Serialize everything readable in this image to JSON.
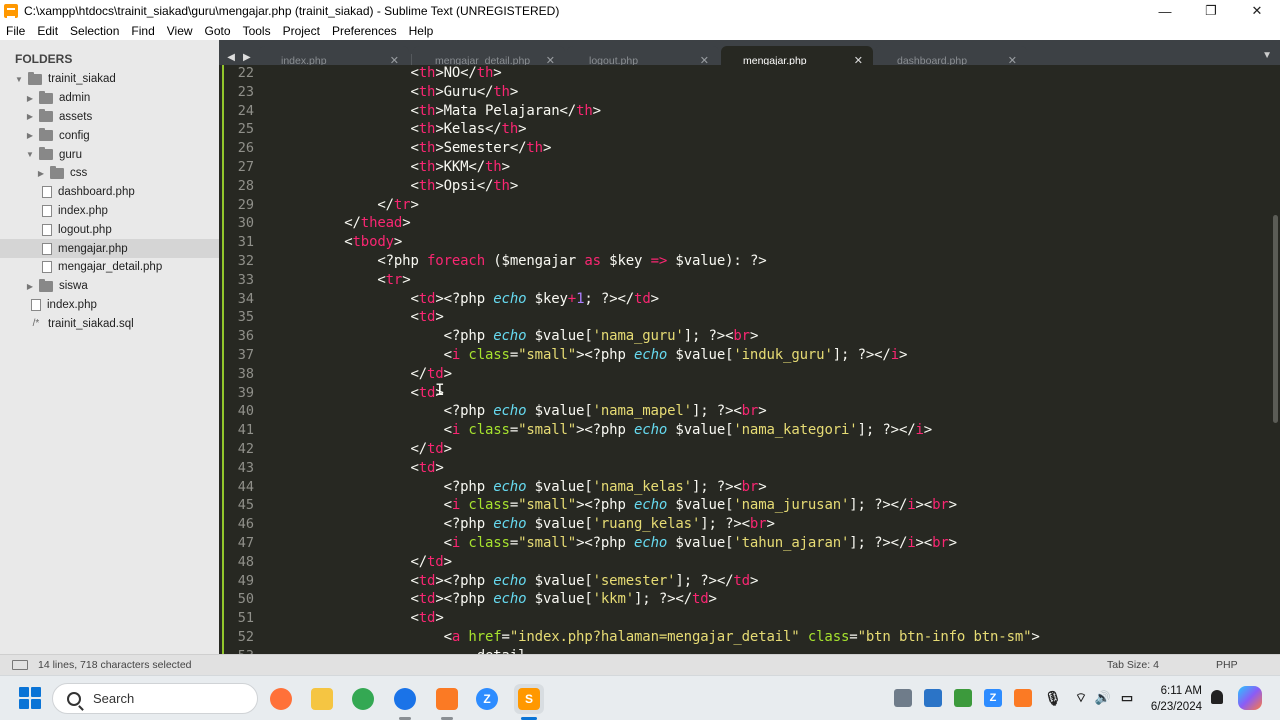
{
  "window": {
    "title": "C:\\xampp\\htdocs\\trainit_siakad\\guru\\mengajar.php (trainit_siakad) - Sublime Text (UNREGISTERED)",
    "controls": [
      "—",
      "❐",
      "✕"
    ]
  },
  "menu": [
    "File",
    "Edit",
    "Selection",
    "Find",
    "View",
    "Goto",
    "Tools",
    "Project",
    "Preferences",
    "Help"
  ],
  "sidebar": {
    "title": "FOLDERS",
    "tree": [
      {
        "label": "trainit_siakad",
        "type": "folder",
        "depth": 0,
        "expanded": true
      },
      {
        "label": "admin",
        "type": "folder",
        "depth": 1,
        "expanded": false
      },
      {
        "label": "assets",
        "type": "folder",
        "depth": 1,
        "expanded": false
      },
      {
        "label": "config",
        "type": "folder",
        "depth": 1,
        "expanded": false
      },
      {
        "label": "guru",
        "type": "folder",
        "depth": 1,
        "expanded": true
      },
      {
        "label": "css",
        "type": "folder",
        "depth": 2,
        "expanded": false
      },
      {
        "label": "dashboard.php",
        "type": "file",
        "depth": 2
      },
      {
        "label": "index.php",
        "type": "file",
        "depth": 2
      },
      {
        "label": "logout.php",
        "type": "file",
        "depth": 2
      },
      {
        "label": "mengajar.php",
        "type": "file",
        "depth": 2,
        "selected": true
      },
      {
        "label": "mengajar_detail.php",
        "type": "file",
        "depth": 2
      },
      {
        "label": "siswa",
        "type": "folder",
        "depth": 1,
        "expanded": false
      },
      {
        "label": "index.php",
        "type": "file",
        "depth": 1
      },
      {
        "label": "trainit_siakad.sql",
        "type": "sql",
        "depth": 1
      }
    ]
  },
  "tabs": [
    {
      "label": "index.php",
      "active": false
    },
    {
      "label": "mengajar_detail.php",
      "active": false
    },
    {
      "label": "logout.php",
      "active": false
    },
    {
      "label": "mengajar.php",
      "active": true
    },
    {
      "label": "dashboard.php",
      "active": false
    }
  ],
  "editor": {
    "lines": [
      {
        "n": "22",
        "segs": [
          [
            "",
            "                <"
          ],
          [
            "tag",
            "th"
          ],
          [
            "",
            ">NO</"
          ],
          [
            "tag",
            "th"
          ],
          [
            "",
            ">"
          ]
        ]
      },
      {
        "n": "23",
        "segs": [
          [
            "",
            "                <"
          ],
          [
            "tag",
            "th"
          ],
          [
            "",
            ">Guru</"
          ],
          [
            "tag",
            "th"
          ],
          [
            "",
            ">"
          ]
        ]
      },
      {
        "n": "24",
        "segs": [
          [
            "",
            "                <"
          ],
          [
            "tag",
            "th"
          ],
          [
            "",
            ">Mata Pelajaran</"
          ],
          [
            "tag",
            "th"
          ],
          [
            "",
            ">"
          ]
        ]
      },
      {
        "n": "25",
        "segs": [
          [
            "",
            "                <"
          ],
          [
            "tag",
            "th"
          ],
          [
            "",
            ">Kelas</"
          ],
          [
            "tag",
            "th"
          ],
          [
            "",
            ">"
          ]
        ]
      },
      {
        "n": "26",
        "segs": [
          [
            "",
            "                <"
          ],
          [
            "tag",
            "th"
          ],
          [
            "",
            ">Semester</"
          ],
          [
            "tag",
            "th"
          ],
          [
            "",
            ">"
          ]
        ]
      },
      {
        "n": "27",
        "segs": [
          [
            "",
            "                <"
          ],
          [
            "tag",
            "th"
          ],
          [
            "",
            ">KKM</"
          ],
          [
            "tag",
            "th"
          ],
          [
            "",
            ">"
          ]
        ]
      },
      {
        "n": "28",
        "segs": [
          [
            "",
            "                <"
          ],
          [
            "tag",
            "th"
          ],
          [
            "",
            ">Opsi</"
          ],
          [
            "tag",
            "th"
          ],
          [
            "",
            ">"
          ]
        ]
      },
      {
        "n": "29",
        "segs": [
          [
            "",
            "            </"
          ],
          [
            "tag",
            "tr"
          ],
          [
            "",
            ">"
          ]
        ]
      },
      {
        "n": "30",
        "segs": [
          [
            "",
            "        </"
          ],
          [
            "tag",
            "thead"
          ],
          [
            "",
            ">"
          ]
        ]
      },
      {
        "n": "31",
        "segs": [
          [
            "",
            "        <"
          ],
          [
            "tag",
            "tbody"
          ],
          [
            "",
            ">"
          ]
        ]
      },
      {
        "n": "32",
        "segs": [
          [
            "",
            "            <?php "
          ],
          [
            "ctl",
            "foreach"
          ],
          [
            "",
            " ($mengajar "
          ],
          [
            "ctl",
            "as"
          ],
          [
            "",
            " $key "
          ],
          [
            "op",
            "=>"
          ],
          [
            "",
            " $value): ?>"
          ]
        ]
      },
      {
        "n": "33",
        "segs": [
          [
            "",
            "            <"
          ],
          [
            "tag",
            "tr"
          ],
          [
            "",
            ">"
          ]
        ]
      },
      {
        "n": "34",
        "segs": [
          [
            "",
            "                <"
          ],
          [
            "tag",
            "td"
          ],
          [
            "",
            "><?php "
          ],
          [
            "kw",
            "echo"
          ],
          [
            "",
            " $key"
          ],
          [
            "op",
            "+"
          ],
          [
            "num",
            "1"
          ],
          [
            "",
            "; ?></"
          ],
          [
            "tag",
            "td"
          ],
          [
            "",
            ">"
          ]
        ]
      },
      {
        "n": "35",
        "segs": [
          [
            "",
            "                <"
          ],
          [
            "tag",
            "td"
          ],
          [
            "",
            ">"
          ]
        ]
      },
      {
        "n": "36",
        "segs": [
          [
            "",
            "                    <?php "
          ],
          [
            "kw",
            "echo"
          ],
          [
            "",
            " $value["
          ],
          [
            "str",
            "'nama_guru'"
          ],
          [
            "",
            "]; ?><"
          ],
          [
            "tag",
            "br"
          ],
          [
            "",
            ">"
          ]
        ]
      },
      {
        "n": "37",
        "segs": [
          [
            "",
            "                    <"
          ],
          [
            "tag",
            "i"
          ],
          [
            "",
            " "
          ],
          [
            "attr",
            "class"
          ],
          [
            "",
            "="
          ],
          [
            "str",
            "\"small\""
          ],
          [
            "",
            "><?php "
          ],
          [
            "kw",
            "echo"
          ],
          [
            "",
            " $value["
          ],
          [
            "str",
            "'induk_guru'"
          ],
          [
            "",
            "]; ?></"
          ],
          [
            "tag",
            "i"
          ],
          [
            "",
            ">"
          ]
        ]
      },
      {
        "n": "38",
        "segs": [
          [
            "",
            "                </"
          ],
          [
            "tag",
            "td"
          ],
          [
            "",
            ">"
          ]
        ]
      },
      {
        "n": "39",
        "segs": [
          [
            "",
            "                <"
          ],
          [
            "tag",
            "td"
          ],
          [
            "",
            ">"
          ]
        ]
      },
      {
        "n": "40",
        "segs": [
          [
            "",
            "                    <?php "
          ],
          [
            "kw",
            "echo"
          ],
          [
            "",
            " $value["
          ],
          [
            "str",
            "'nama_mapel'"
          ],
          [
            "",
            "]; ?><"
          ],
          [
            "tag",
            "br"
          ],
          [
            "",
            ">"
          ]
        ]
      },
      {
        "n": "41",
        "segs": [
          [
            "",
            "                    <"
          ],
          [
            "tag",
            "i"
          ],
          [
            "",
            " "
          ],
          [
            "attr",
            "class"
          ],
          [
            "",
            "="
          ],
          [
            "str",
            "\"small\""
          ],
          [
            "",
            "><?php "
          ],
          [
            "kw",
            "echo"
          ],
          [
            "",
            " $value["
          ],
          [
            "str",
            "'nama_kategori'"
          ],
          [
            "",
            "]; ?></"
          ],
          [
            "tag",
            "i"
          ],
          [
            "",
            ">"
          ]
        ]
      },
      {
        "n": "42",
        "segs": [
          [
            "",
            "                </"
          ],
          [
            "tag",
            "td"
          ],
          [
            "",
            ">"
          ]
        ]
      },
      {
        "n": "43",
        "segs": [
          [
            "",
            "                <"
          ],
          [
            "tag",
            "td"
          ],
          [
            "",
            ">"
          ]
        ]
      },
      {
        "n": "44",
        "segs": [
          [
            "",
            "                    <?php "
          ],
          [
            "kw",
            "echo"
          ],
          [
            "",
            " $value["
          ],
          [
            "str",
            "'nama_kelas'"
          ],
          [
            "",
            "]; ?><"
          ],
          [
            "tag",
            "br"
          ],
          [
            "",
            ">"
          ]
        ]
      },
      {
        "n": "45",
        "segs": [
          [
            "",
            "                    <"
          ],
          [
            "tag",
            "i"
          ],
          [
            "",
            " "
          ],
          [
            "attr",
            "class"
          ],
          [
            "",
            "="
          ],
          [
            "str",
            "\"small\""
          ],
          [
            "",
            "><?php "
          ],
          [
            "kw",
            "echo"
          ],
          [
            "",
            " $value["
          ],
          [
            "str",
            "'nama_jurusan'"
          ],
          [
            "",
            "]; ?></"
          ],
          [
            "tag",
            "i"
          ],
          [
            "",
            "><"
          ],
          [
            "tag",
            "br"
          ],
          [
            "",
            ">"
          ]
        ]
      },
      {
        "n": "46",
        "segs": [
          [
            "",
            "                    <?php "
          ],
          [
            "kw",
            "echo"
          ],
          [
            "",
            " $value["
          ],
          [
            "str",
            "'ruang_kelas'"
          ],
          [
            "",
            "]; ?><"
          ],
          [
            "tag",
            "br"
          ],
          [
            "",
            ">"
          ]
        ]
      },
      {
        "n": "47",
        "segs": [
          [
            "",
            "                    <"
          ],
          [
            "tag",
            "i"
          ],
          [
            "",
            " "
          ],
          [
            "attr",
            "class"
          ],
          [
            "",
            "="
          ],
          [
            "str",
            "\"small\""
          ],
          [
            "",
            "><?php "
          ],
          [
            "kw",
            "echo"
          ],
          [
            "",
            " $value["
          ],
          [
            "str",
            "'tahun_ajaran'"
          ],
          [
            "",
            "]; ?></"
          ],
          [
            "tag",
            "i"
          ],
          [
            "",
            "><"
          ],
          [
            "tag",
            "br"
          ],
          [
            "",
            ">"
          ]
        ]
      },
      {
        "n": "48",
        "segs": [
          [
            "",
            "                </"
          ],
          [
            "tag",
            "td"
          ],
          [
            "",
            ">"
          ]
        ]
      },
      {
        "n": "49",
        "segs": [
          [
            "",
            "                <"
          ],
          [
            "tag",
            "td"
          ],
          [
            "",
            "><?php "
          ],
          [
            "kw",
            "echo"
          ],
          [
            "",
            " $value["
          ],
          [
            "str",
            "'semester'"
          ],
          [
            "",
            "]; ?></"
          ],
          [
            "tag",
            "td"
          ],
          [
            "",
            ">"
          ]
        ]
      },
      {
        "n": "50",
        "segs": [
          [
            "",
            "                <"
          ],
          [
            "tag",
            "td"
          ],
          [
            "",
            "><?php "
          ],
          [
            "kw",
            "echo"
          ],
          [
            "",
            " $value["
          ],
          [
            "str",
            "'kkm'"
          ],
          [
            "",
            "]; ?></"
          ],
          [
            "tag",
            "td"
          ],
          [
            "",
            ">"
          ]
        ]
      },
      {
        "n": "51",
        "segs": [
          [
            "",
            "                <"
          ],
          [
            "tag",
            "td"
          ],
          [
            "",
            ">"
          ]
        ]
      },
      {
        "n": "52",
        "segs": [
          [
            "",
            "                    <"
          ],
          [
            "tag",
            "a"
          ],
          [
            "",
            " "
          ],
          [
            "attr",
            "href"
          ],
          [
            "",
            "="
          ],
          [
            "str",
            "\"index.php?halaman=mengajar_detail\""
          ],
          [
            "",
            " "
          ],
          [
            "attr",
            "class"
          ],
          [
            "",
            "="
          ],
          [
            "str",
            "\"btn btn-info btn-sm\""
          ],
          [
            "",
            ">"
          ]
        ]
      },
      {
        "n": "53",
        "segs": [
          [
            "",
            "                        detail"
          ]
        ]
      }
    ]
  },
  "status": {
    "selection": "14 lines, 718 characters selected",
    "tab_size": "Tab Size: 4",
    "syntax": "PHP"
  },
  "taskbar": {
    "search_placeholder": "Search",
    "apps": [
      {
        "name": "firefox-icon",
        "color": "#ff7139"
      },
      {
        "name": "file-explorer-icon",
        "color": "#f5c542"
      },
      {
        "name": "chrome-icon",
        "color": "#34a853"
      },
      {
        "name": "chrome-profile-icon",
        "color": "#1a73e8"
      },
      {
        "name": "xampp-icon",
        "color": "#fb7a24"
      },
      {
        "name": "zoom-icon",
        "color": "#2d8cff"
      },
      {
        "name": "sublime-text-icon",
        "color": "#ff9800"
      }
    ],
    "time": "6:11 AM",
    "date": "6/23/2024"
  }
}
